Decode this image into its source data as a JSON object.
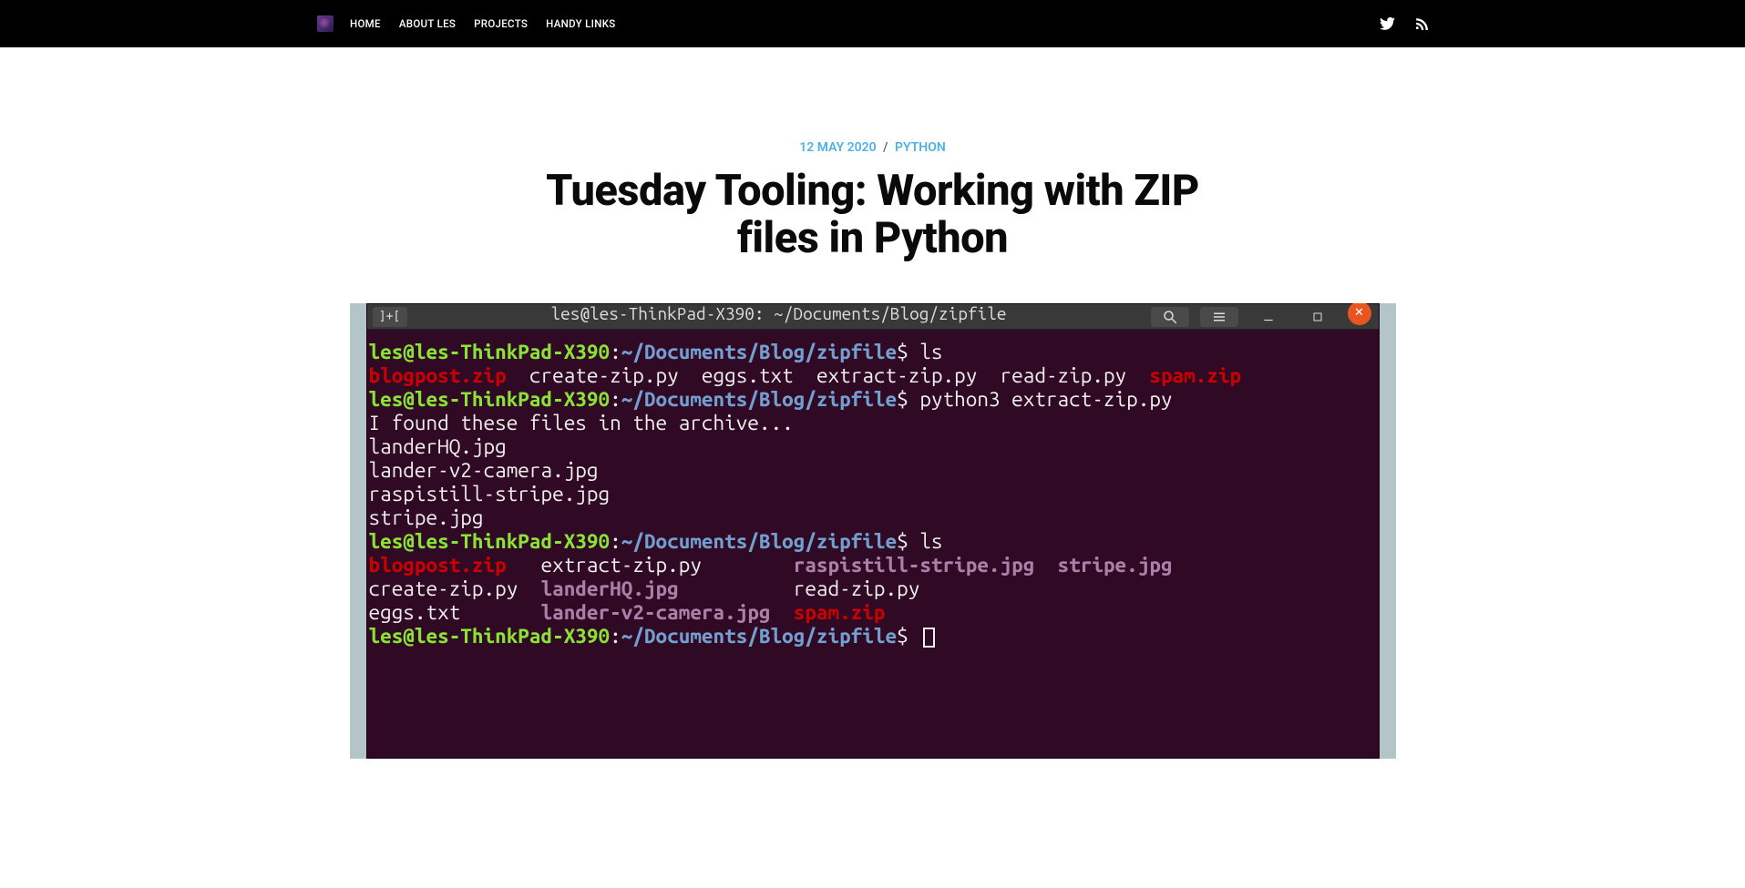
{
  "nav": {
    "home": "HOME",
    "about": "ABOUT LES",
    "projects": "PROJECTS",
    "handy": "HANDY LINKS"
  },
  "post": {
    "date": "12 MAY 2020",
    "category": "PYTHON",
    "title": "Tuesday Tooling: Working with ZIP files in Python"
  },
  "terminal": {
    "window_title": "les@les-ThinkPad-X390: ~/Documents/Blog/zipfile",
    "prompt_user": "les@les-ThinkPad-X390",
    "prompt_path": "~/Documents/Blog/zipfile",
    "cmd_ls": "ls",
    "cmd_py": "python3 extract-zip.py",
    "found_msg": "I found these files in the archive...",
    "archive_files": {
      "f1": "landerHQ.jpg",
      "f2": "lander-v2-camera.jpg",
      "f3": "raspistill-stripe.jpg",
      "f4": "stripe.jpg"
    },
    "ls1": {
      "blogpost": "blogpost.zip",
      "createzip": "create-zip.py",
      "eggs": "eggs.txt",
      "extractzip": "extract-zip.py",
      "readzip": "read-zip.py",
      "spam": "spam.zip"
    },
    "ls2_row1": {
      "blogpost": "blogpost.zip",
      "extractzip": "extract-zip.py",
      "raspistill": "raspistill-stripe.jpg",
      "stripe": "stripe.jpg"
    },
    "ls2_row2": {
      "createzip": "create-zip.py",
      "landerhq": "landerHQ.jpg",
      "readzip": "read-zip.py"
    },
    "ls2_row3": {
      "eggs": "eggs.txt",
      "landerv2": "lander-v2-camera.jpg",
      "spam": "spam.zip"
    }
  }
}
